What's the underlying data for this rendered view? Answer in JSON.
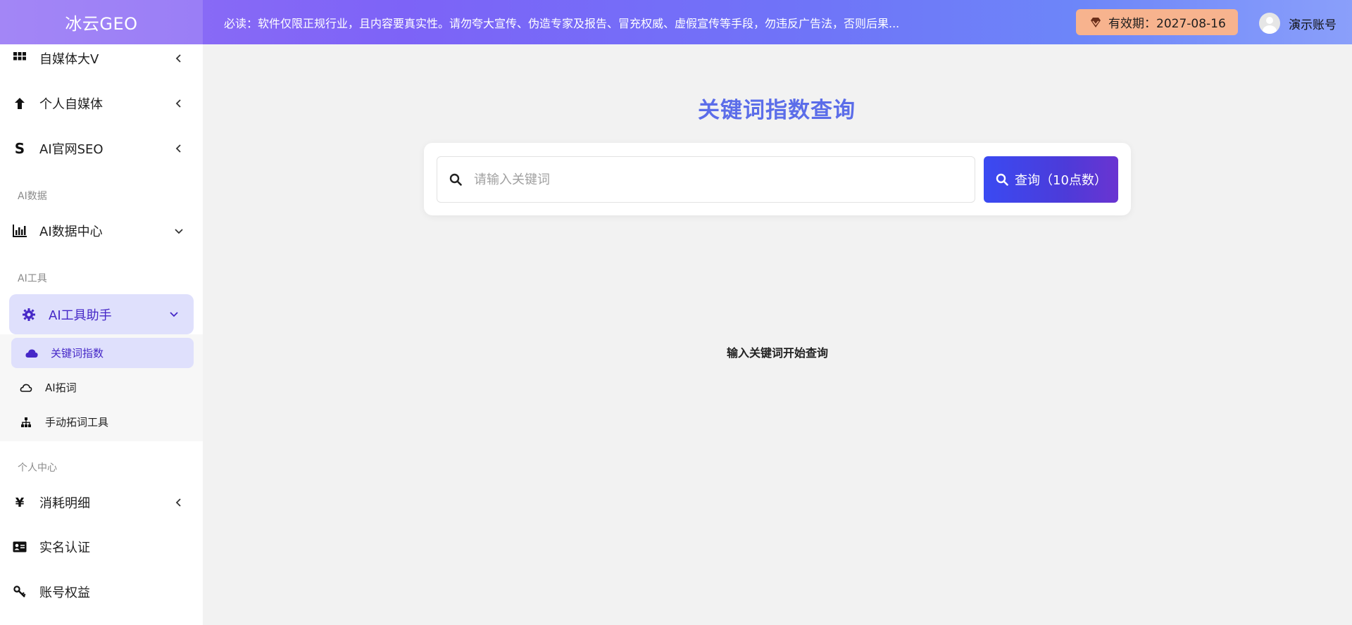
{
  "header": {
    "brand": "冰云GEO",
    "notice": "必读：软件仅限正规行业，且内容要真实性。请勿夸大宣传、伪造专家及报告、冒充权威、虚假宣传等手段，勿违反广告法，否则后果...",
    "expiry": "有效期：2027-08-16",
    "user_name": "演示账号"
  },
  "sidebar": {
    "items_top": [
      {
        "label": "自媒体大V",
        "icon": "grid-icon"
      },
      {
        "label": "个人自媒体",
        "icon": "arrow-up-icon"
      },
      {
        "label": "AI官网SEO",
        "icon": "seo-s-icon"
      }
    ],
    "section_ai_data": "AI数据",
    "ai_data_center": "AI数据中心",
    "section_ai_tools": "AI工具",
    "ai_tools_helper": "AI工具助手",
    "sub_items": [
      {
        "label": "关键词指数",
        "icon": "cloud-icon"
      },
      {
        "label": "AI拓词",
        "icon": "cloud-outline-icon"
      },
      {
        "label": "手动拓词工具",
        "icon": "sitemap-icon"
      }
    ],
    "section_personal": "个人中心",
    "items_bottom": [
      {
        "label": "消耗明细",
        "icon": "yen-icon"
      },
      {
        "label": "实名认证",
        "icon": "id-card-icon"
      },
      {
        "label": "账号权益",
        "icon": "key-icon"
      }
    ]
  },
  "main": {
    "title": "关键词指数查询",
    "search_placeholder": "请输入关键词",
    "query_button": "查询（10点数）",
    "empty_hint": "输入关键词开始查询"
  },
  "colors": {
    "accent": "#5b6de9",
    "active_bg": "#dfe0fc",
    "active_text": "#4527c7",
    "expiry_bg": "#f7b38e"
  }
}
